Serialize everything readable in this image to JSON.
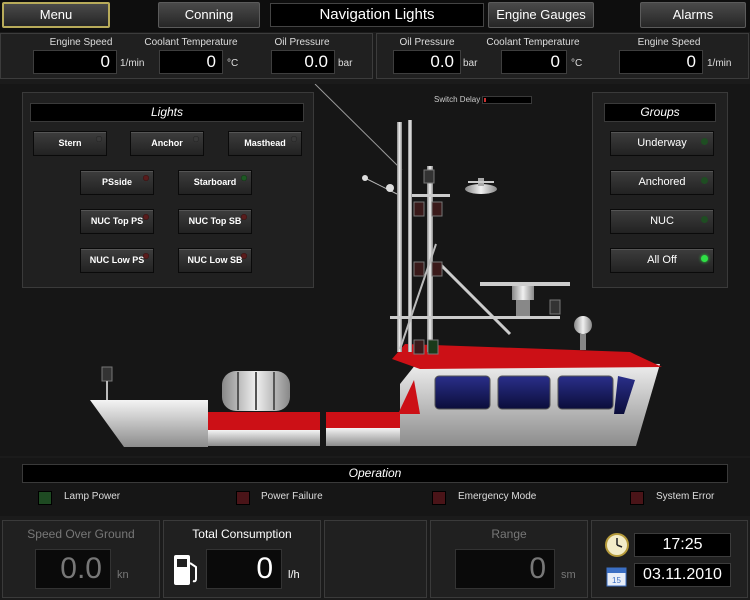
{
  "nav": {
    "menu": "Menu",
    "conning": "Conning",
    "title": "Navigation Lights",
    "engine_gauges": "Engine Gauges",
    "alarms": "Alarms"
  },
  "engine_left": {
    "speed_label": "Engine Speed",
    "speed_value": "0",
    "speed_unit": "1/min",
    "coolant_label": "Coolant Temperature",
    "coolant_value": "0",
    "coolant_unit": "°C",
    "oil_label": "Oil Pressure",
    "oil_value": "0.0",
    "oil_unit": "bar"
  },
  "engine_right": {
    "oil_label": "Oil Pressure",
    "oil_value": "0.0",
    "oil_unit": "bar",
    "coolant_label": "Coolant Temperature",
    "coolant_value": "0",
    "coolant_unit": "°C",
    "speed_label": "Engine Speed",
    "speed_value": "0",
    "speed_unit": "1/min"
  },
  "lights": {
    "title": "Lights",
    "stern": "Stern",
    "anchor": "Anchor",
    "masthead": "Masthead",
    "psside": "PSside",
    "starboard": "Starboard",
    "nuc_top_ps": "NUC Top PS",
    "nuc_top_sb": "NUC Top SB",
    "nuc_low_ps": "NUC Low PS",
    "nuc_low_sb": "NUC Low SB"
  },
  "switch_delay": "Switch Delay",
  "groups": {
    "title": "Groups",
    "underway": "Underway",
    "anchored": "Anchored",
    "nuc": "NUC",
    "all_off": "All Off"
  },
  "operation": {
    "title": "Operation",
    "lamp_power": "Lamp Power",
    "power_failure": "Power Failure",
    "emergency_mode": "Emergency Mode",
    "system_error": "System Error"
  },
  "bottom": {
    "sog_title": "Speed Over Ground",
    "sog_value": "0.0",
    "sog_unit": "kn",
    "consumption_title": "Total Consumption",
    "consumption_value": "0",
    "consumption_unit": "l/h",
    "range_title": "Range",
    "range_value": "0",
    "range_unit": "sm",
    "time": "17:25",
    "date": "03.11.2010",
    "calendar_day": "15"
  },
  "colors": {
    "hull_red": "#cc1016",
    "led_green_on": "#2ee045",
    "led_red_off": "#5a1c1c",
    "active_border": "#b8ab5a"
  }
}
